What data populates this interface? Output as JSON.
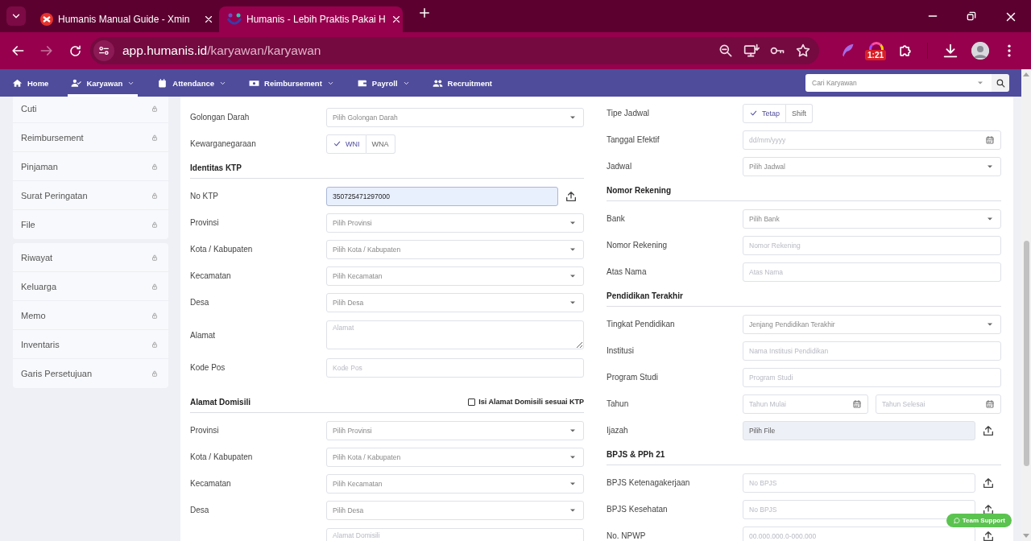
{
  "browser": {
    "tabs": [
      {
        "title": "Humanis Manual Guide - Xmin",
        "selected": false
      },
      {
        "title": "Humanis - Lebih Praktis Pakai H",
        "selected": true
      }
    ],
    "forward_disabled": true,
    "url": {
      "host": "app.humanis.id",
      "path": "/karyawan/karyawan"
    },
    "extension_badge": "1:21"
  },
  "nav": {
    "items": [
      {
        "label": "Home",
        "dropdown": false,
        "selected": false
      },
      {
        "label": "Karyawan",
        "dropdown": true,
        "selected": true
      },
      {
        "label": "Attendance",
        "dropdown": true,
        "selected": false
      },
      {
        "label": "Reimbursement",
        "dropdown": true,
        "selected": false
      },
      {
        "label": "Payroll",
        "dropdown": true,
        "selected": false
      },
      {
        "label": "Recruitment",
        "dropdown": false,
        "selected": false
      }
    ],
    "search": {
      "placeholder": "Cari Karyawan"
    }
  },
  "sidebar": {
    "groups": [
      {
        "items": [
          {
            "label": "Cuti",
            "locked": true
          },
          {
            "label": "Reimbursement",
            "locked": true
          },
          {
            "label": "Pinjaman",
            "locked": true
          },
          {
            "label": "Surat Peringatan",
            "locked": true
          },
          {
            "label": "File",
            "locked": true
          }
        ]
      },
      {
        "items": [
          {
            "label": "Riwayat",
            "locked": true
          },
          {
            "label": "Keluarga",
            "locked": true
          },
          {
            "label": "Memo",
            "locked": true
          },
          {
            "label": "Inventaris",
            "locked": true
          },
          {
            "label": "Garis Persetujuan",
            "locked": true
          }
        ]
      }
    ]
  },
  "form": {
    "columns": [
      [
        {
          "kind": "select",
          "label": "Golongan Darah",
          "placeholder": "Pilih Golongan Darah"
        },
        {
          "kind": "toggle",
          "label": "Kewarganegaraan",
          "options": [
            {
              "label": "WNI",
              "selected": true
            },
            {
              "label": "WNA",
              "selected": false
            }
          ]
        },
        {
          "kind": "section",
          "title": "Identitas KTP"
        },
        {
          "kind": "input",
          "label": "No KTP",
          "value": "350725471297000",
          "focused": true,
          "upload": true
        },
        {
          "kind": "select",
          "label": "Provinsi",
          "placeholder": "Pilih Provinsi"
        },
        {
          "kind": "select",
          "label": "Kota / Kabupaten",
          "placeholder": "Pilih Kota / Kabupaten"
        },
        {
          "kind": "select",
          "label": "Kecamatan",
          "placeholder": "Pilih Kecamatan"
        },
        {
          "kind": "select",
          "label": "Desa",
          "placeholder": "Pilih Desa"
        },
        {
          "kind": "textarea",
          "label": "Alamat",
          "placeholder": "Alamat"
        },
        {
          "kind": "input",
          "label": "Kode Pos",
          "placeholder": "Kode Pos"
        },
        {
          "kind": "section",
          "title": "Alamat Domisili",
          "checkbox": {
            "label": "Isi Alamat Domisili sesuai KTP",
            "checked": false
          }
        },
        {
          "kind": "select",
          "label": "Provinsi",
          "placeholder": "Pilih Provinsi"
        },
        {
          "kind": "select",
          "label": "Kota / Kabupaten",
          "placeholder": "Pilih Kota / Kabupaten"
        },
        {
          "kind": "select",
          "label": "Kecamatan",
          "placeholder": "Pilih Kecamatan"
        },
        {
          "kind": "select",
          "label": "Desa",
          "placeholder": "Pilih Desa"
        },
        {
          "kind": "textarea",
          "placeholder": "Alamat Domisili"
        }
      ],
      [
        {
          "kind": "toggle",
          "label": "Tipe Jadwal",
          "options": [
            {
              "label": "Tetap",
              "selected": true
            },
            {
              "label": "Shift",
              "selected": false
            }
          ]
        },
        {
          "kind": "date",
          "label": "Tanggal Efektif",
          "fields": [
            {
              "placeholder": "dd/mm/yyyy"
            }
          ]
        },
        {
          "kind": "select",
          "label": "Jadwal",
          "placeholder": "Pilih Jadwal"
        },
        {
          "kind": "section",
          "title": "Nomor Rekening"
        },
        {
          "kind": "select",
          "label": "Bank",
          "placeholder": "Pilih Bank"
        },
        {
          "kind": "input",
          "label": "Nomor Rekening",
          "placeholder": "Nomor Rekening"
        },
        {
          "kind": "input",
          "label": "Atas Nama",
          "placeholder": "Atas Nama"
        },
        {
          "kind": "section",
          "title": "Pendidikan Terakhir"
        },
        {
          "kind": "select",
          "label": "Tingkat Pendidikan",
          "placeholder": "Jenjang Pendidikan Terakhir"
        },
        {
          "kind": "input",
          "label": "Institusi",
          "placeholder": "Nama Institusi Pendidikan"
        },
        {
          "kind": "input",
          "label": "Program Studi",
          "placeholder": "Program Studi"
        },
        {
          "kind": "date",
          "label": "Tahun",
          "fields": [
            {
              "placeholder": "Tahun Mulai"
            },
            {
              "placeholder": "Tahun Selesai"
            }
          ]
        },
        {
          "kind": "file",
          "label": "Ijazah",
          "button": "Pilih File",
          "upload": true
        },
        {
          "kind": "section",
          "title": "BPJS & PPh 21"
        },
        {
          "kind": "input",
          "label": "BPJS Ketenagakerjaan",
          "placeholder": "No BPJS",
          "upload": true
        },
        {
          "kind": "input",
          "label": "BPJS Kesehatan",
          "placeholder": "No BPJS",
          "upload": true
        },
        {
          "kind": "input",
          "label": "No. NPWP",
          "placeholder": "00.000.000.0-000.000",
          "upload": true
        }
      ]
    ]
  },
  "support_button": {
    "label": "Team Support"
  }
}
